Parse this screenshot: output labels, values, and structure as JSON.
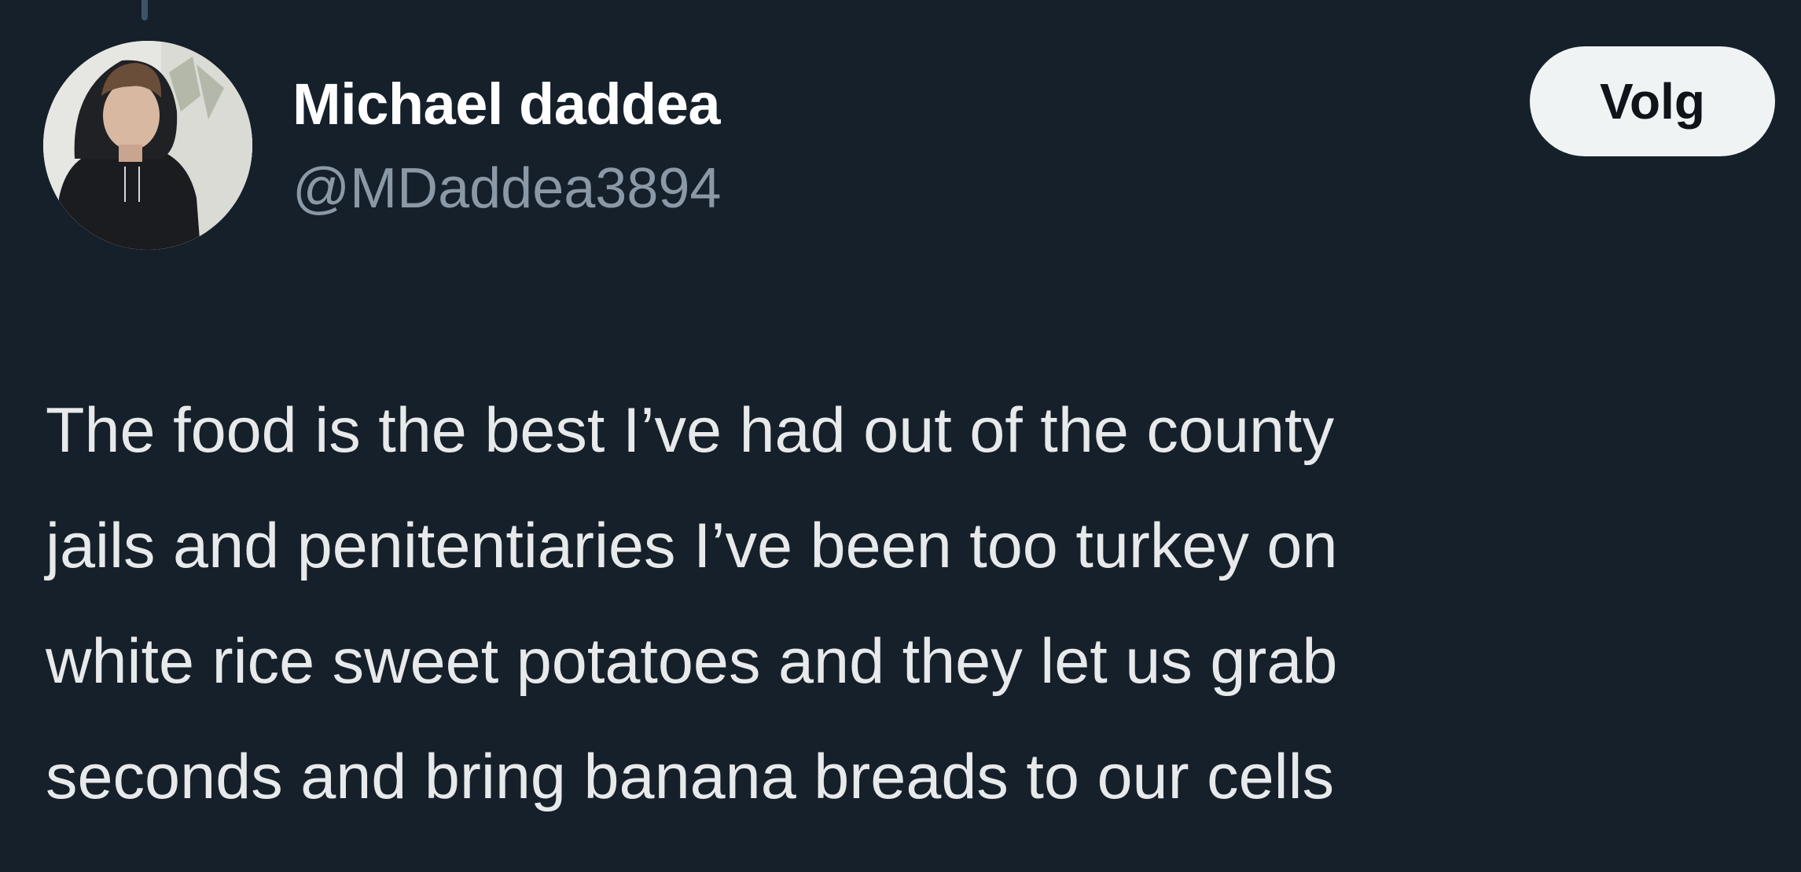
{
  "author": {
    "display_name": "Michael daddea",
    "handle": "@MDaddea3894",
    "avatar_icon": "profile-photo"
  },
  "actions": {
    "follow_label": "Volg"
  },
  "tweet": {
    "lines": [
      "The food is the best I’ve had out of the county",
      "jails and penitentiaries I’ve been too turkey on",
      "white rice sweet potatoes and they let us grab",
      "seconds and bring banana breads to our cells"
    ]
  },
  "colors": {
    "background": "#15202b",
    "primary_text": "#e7e9ea",
    "secondary_text": "#8b98a5",
    "button_bg": "#eff3f4",
    "button_text": "#0f1419"
  }
}
